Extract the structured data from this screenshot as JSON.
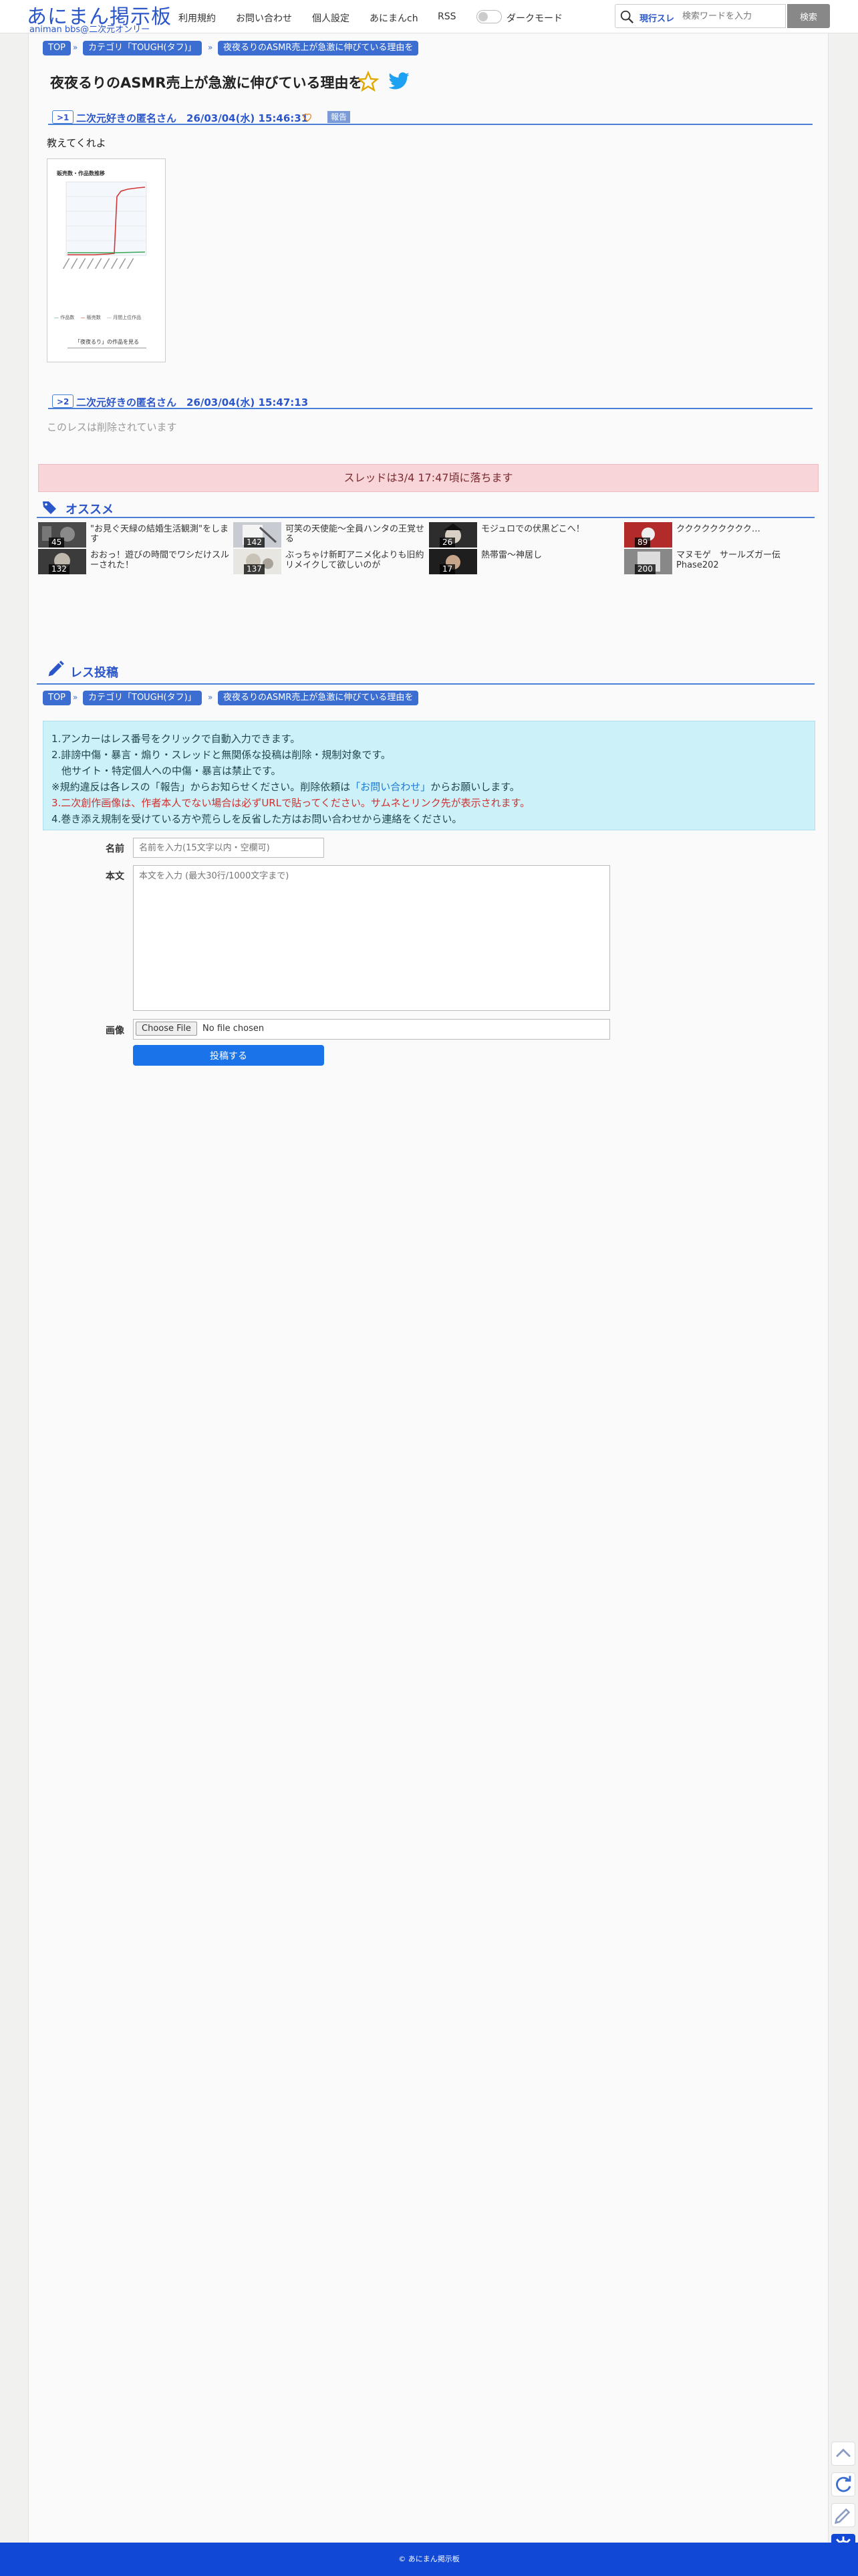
{
  "header": {
    "logo_main": "あにまん掲示板",
    "logo_sub": "animan bbs@二次元オンリー",
    "nav": [
      "利用規約",
      "お問い合わせ",
      "個人設定",
      "あにまんch",
      "RSS"
    ],
    "dark_mode_label": "ダークモード",
    "search_scope": "現行スレ",
    "search_placeholder": "検索ワードを入力",
    "search_button": "検索"
  },
  "breadcrumb": {
    "items": [
      "TOP",
      "カテゴリ「TOUGH(タフ)」",
      "夜夜るりのASMR売上が急激に伸びている理由を"
    ]
  },
  "thread": {
    "title": "夜夜るりのASMR売上が急激に伸びている理由を"
  },
  "posts": [
    {
      "num": ">1",
      "name_date": "二次元好きの匿名さん　26/03/04(水) 15:46:31",
      "report": "報告",
      "body": "教えてくれよ"
    },
    {
      "num": ">2",
      "name_date": "二次元好きの匿名さん　26/03/04(水) 15:47:13",
      "body": "このレスは削除されています"
    }
  ],
  "chart_image": {
    "title": "販売数・作品数推移",
    "legend": [
      "作品数",
      "販売数",
      "月間上位作品"
    ],
    "caption": "「夜夜るり」の作品を見る",
    "line_color": "#d03535",
    "flat_color": "#3aa655"
  },
  "alert": "スレッドは3/4 17:47頃に落ちます",
  "recommend": {
    "title": "オススメ",
    "items": [
      {
        "title": "\"お見ぐ天緑の結婚生活観測\"をします",
        "count": "45"
      },
      {
        "title": "可笑の天使能〜全員ハンタの王覚せる",
        "count": "142"
      },
      {
        "title": "モジュロでの伏黒どこへ！",
        "count": "26"
      },
      {
        "title": "ククククククククク…",
        "count": "89"
      },
      {
        "title": "おおっ！遊びの時間でワシだけスルーされた！",
        "count": "132"
      },
      {
        "title": "ぶっちゃけ新町アニメ化よりも旧約リメイクして欲しいのが",
        "count": "137"
      },
      {
        "title": "熱帯雷〜神居し",
        "count": "17"
      },
      {
        "title": "マヌモゲ　サールズガー伝　Phase202",
        "count": "200"
      }
    ]
  },
  "post_form": {
    "title": "レス投稿",
    "rules": {
      "line1": "1.アンカーはレス番号をクリックで自動入力できます。",
      "line2": "2.誹謗中傷・暴言・煽り・スレッドと無関係な投稿は削除・規制対象です。",
      "line3": "　他サイト・特定個人への中傷・暴言は禁止です。",
      "line4a": "※規約違反は各レスの「報告」からお知らせください。削除依頼は",
      "line4b": "「お問い合わせ」",
      "line4c": "からお願いします。",
      "line5a": "3.二次創作画像は、",
      "line5b": "作者本人でない場合は必ずURLで貼ってください。サムネとリンク先が表示されます。",
      "line6": "4.巻き添え規制を受けている方や荒らしを反省した方はお問い合わせから連絡をください。"
    },
    "name_label": "名前",
    "name_placeholder": "名前を入力(15文字以内・空欄可)",
    "body_label": "本文",
    "body_placeholder": "本文を入力 (最大30行/1000文字まで)",
    "image_label": "画像",
    "file_button": "Choose File",
    "file_status": "No file chosen",
    "submit": "投稿する"
  },
  "footer": "© あにまん掲示板"
}
